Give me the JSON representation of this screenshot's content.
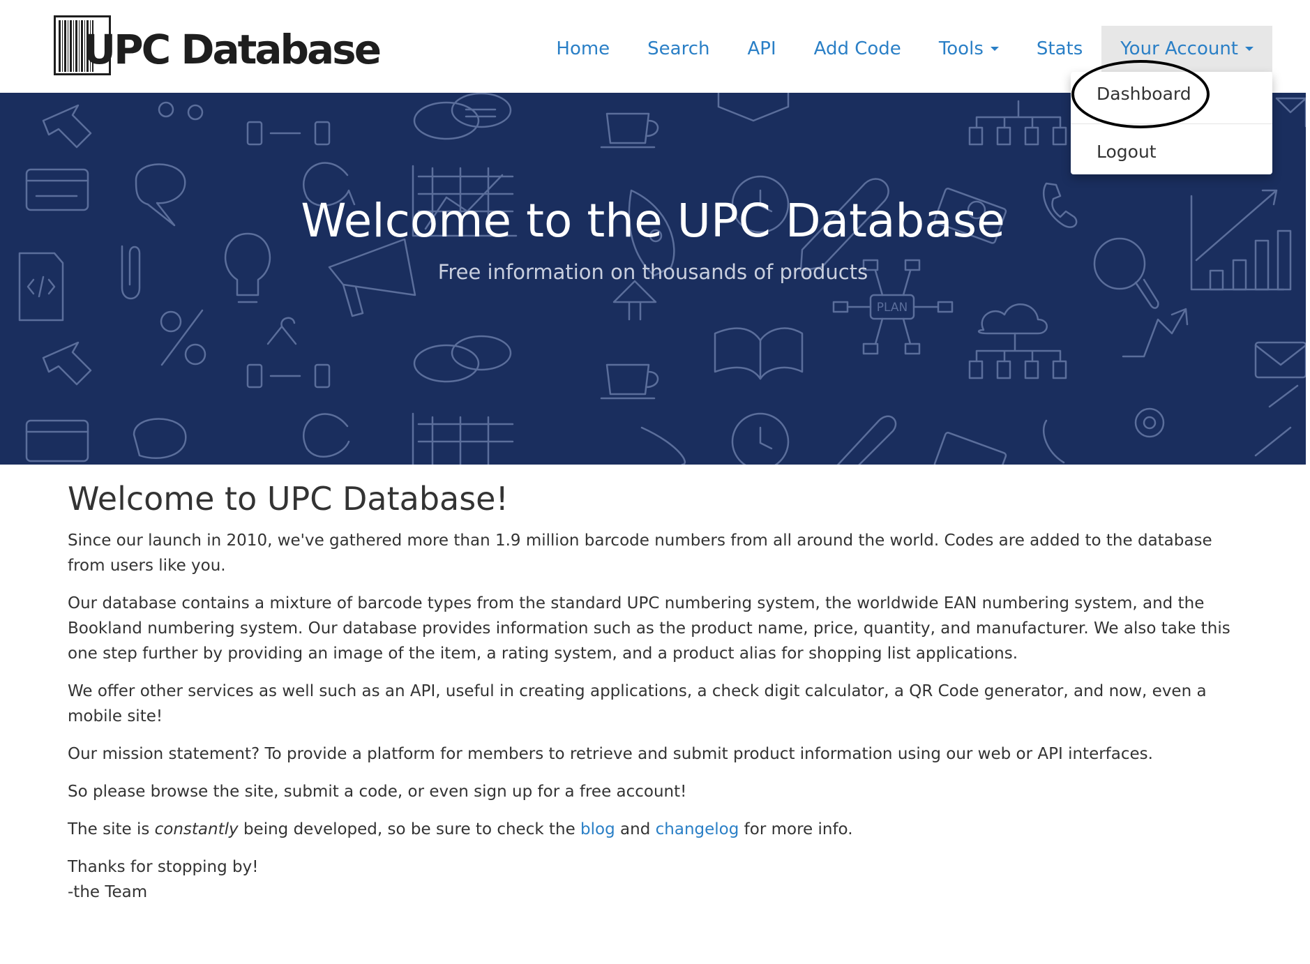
{
  "brand": {
    "logo_text": "UPC Database"
  },
  "nav": {
    "items": [
      {
        "label": "Home"
      },
      {
        "label": "Search"
      },
      {
        "label": "API"
      },
      {
        "label": "Add Code"
      },
      {
        "label": "Tools"
      },
      {
        "label": "Stats"
      },
      {
        "label": "Your Account"
      }
    ]
  },
  "account_menu": {
    "dashboard": "Dashboard",
    "logout": "Logout"
  },
  "hero": {
    "title": "Welcome to the UPC Database",
    "subtitle": "Free information on thousands of products",
    "doodle_label": "PLAN"
  },
  "content": {
    "heading": "Welcome to UPC Database!",
    "p1": "Since our launch in 2010, we've gathered more than 1.9 million barcode numbers from all around the world. Codes are added to the database from users like you.",
    "p2": "Our database contains a mixture of barcode types from the standard UPC numbering system, the worldwide EAN numbering system, and the Bookland numbering system. Our database provides information such as the product name, price, quantity, and manufacturer. We also take this one step further by providing an image of the item, a rating system, and a product alias for shopping list applications.",
    "p3": "We offer other services as well such as an API, useful in creating applications, a check digit calculator, a QR Code generator, and now, even a mobile site!",
    "p4": "Our mission statement? To provide a platform for members to retrieve and submit product information using our web or API interfaces.",
    "p5": "So please browse the site, submit a code, or even sign up for a free account!",
    "p6_before": "The site is",
    "p6_emphasis": "constantly",
    "p6_middle": "being developed, so be sure to check the",
    "blog_link": "blog",
    "p6_and": "and",
    "changelog_link": "changelog",
    "p6_after": "for more info.",
    "thanks": "Thanks for stopping by!",
    "signature": "-the Team"
  },
  "colors": {
    "link": "#2a7fc6",
    "hero_bg": "#1a2e5e",
    "nav_active_bg": "#e7e7e7",
    "text": "#333333"
  },
  "icons": [
    "barcode-logo-icon",
    "caret-down-icon"
  ]
}
